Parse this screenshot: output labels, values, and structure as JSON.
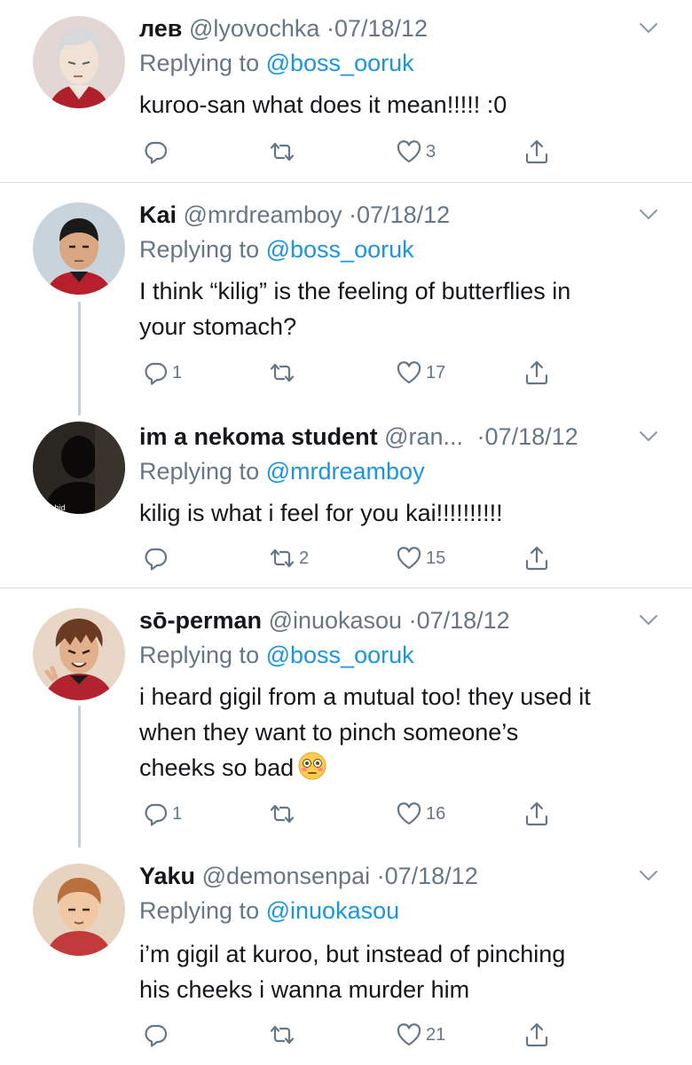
{
  "tweets": [
    {
      "name": "лев",
      "handle": "@lyovochka",
      "dot": "·",
      "date": "07/18/12",
      "replying_prefix": "Replying to",
      "replying_to": "@boss_ooruk",
      "text": "kuroo-san what does it mean!!!!! :0",
      "replies": "",
      "retweets": "",
      "likes": "3",
      "avatar_icon": "avatar-lev"
    },
    {
      "name": "Kai",
      "handle": "@mrdreamboy",
      "dot": "·",
      "date": "07/18/12",
      "replying_prefix": "Replying to",
      "replying_to": "@boss_ooruk",
      "text_lines": [
        "I think “kilig” is the feeling of butterflies in",
        "your stomach?"
      ],
      "replies": "1",
      "retweets": "",
      "likes": "17",
      "avatar_icon": "avatar-kai"
    },
    {
      "name": "im a nekoma student",
      "handle": "@ran...",
      "dot": "·",
      "date": "07/18/12",
      "replying_prefix": "Replying to",
      "replying_to": "@mrdreamboy",
      "text": "kilig is what i feel for you kai!!!!!!!!!!",
      "replies": "",
      "retweets": "2",
      "likes": "15",
      "avatar_icon": "avatar-silhouette",
      "avatar_caption": "bs in hid"
    },
    {
      "name": "sō-perman",
      "handle": "@inuokasou",
      "dot": "·",
      "date": "07/18/12",
      "replying_prefix": "Replying to",
      "replying_to": "@boss_ooruk",
      "text_lines": [
        "i heard gigil from a mutual too! they used it",
        "when they want to pinch someone’s",
        "cheeks so bad"
      ],
      "replies": "1",
      "retweets": "",
      "likes": "16",
      "avatar_icon": "avatar-soperman",
      "emoji_icon": "flushed-face-emoji"
    },
    {
      "name": "Yaku",
      "handle": "@demonsenpai",
      "dot": "·",
      "date": "07/18/12",
      "replying_prefix": "Replying to",
      "replying_to": "@inuokasou",
      "text_lines": [
        "i’m gigil at kuroo, but instead of pinching",
        "his cheeks i wanna murder him"
      ],
      "replies": "",
      "retweets": "",
      "likes": "21",
      "avatar_icon": "avatar-yaku"
    }
  ],
  "colors": {
    "text": "#14171a",
    "secondary": "#657786",
    "link": "#1b95e0",
    "divider": "#dadfe3",
    "thread_line": "#c4cfd6"
  }
}
